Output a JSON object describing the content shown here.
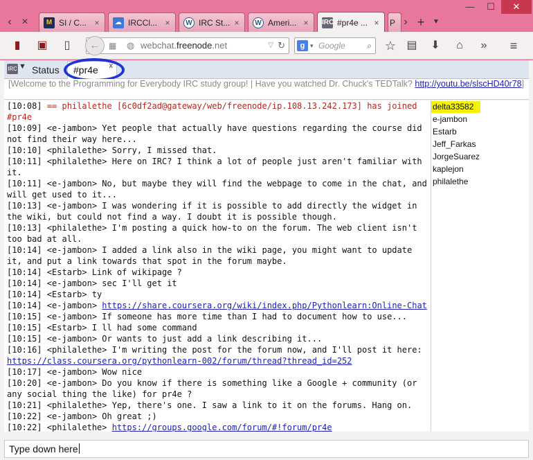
{
  "browser": {
    "tabs": [
      {
        "label": "SI / C...",
        "icon": "umich-block-m-icon",
        "icon_color": "#1f2a5c",
        "icon_fg": "#f5c518"
      },
      {
        "label": "IRCCl...",
        "icon": "cloud-icon",
        "icon_color": "#3a7ad6",
        "icon_fg": "#ffffff"
      },
      {
        "label": "IRC St...",
        "icon": "wordpress-icon",
        "icon_color": "#ffffff",
        "icon_fg": "#2a5b84"
      },
      {
        "label": "Ameri...",
        "icon": "wordpress-icon",
        "icon_color": "#ffffff",
        "icon_fg": "#2a5b84"
      },
      {
        "label": "#pr4e ...",
        "icon": "irc-cloud-icon",
        "icon_color": "#666677",
        "icon_fg": "#ffffff",
        "active": true
      },
      {
        "label": "P"
      }
    ],
    "tab_close_glyph": "×",
    "url_domain": "webchat.",
    "url_host": "freenode",
    "url_tld": ".net",
    "search_placeholder": "Google",
    "search_engine_letter": "g",
    "window_controls": {
      "minimize": "—",
      "maximize": "☐",
      "close": "✕"
    }
  },
  "irc": {
    "status_tab": "Status",
    "channel_tab": "#pr4e",
    "channel_tab_close": "x",
    "topic_text": "[Welcome to the Programming for Everybody IRC study group! | Have you watched Dr. Chuck's TEDTalk? ",
    "topic_link": "http://youtu.be/slscHD40r78",
    "topic_close": "]",
    "messages": [
      {
        "time": "[10:08]",
        "text": "== philalethe [6c0df2ad@gateway/web/freenode/ip.108.13.242.173] has joined #pr4e",
        "kind": "join"
      },
      {
        "time": "[10:09]",
        "text": "<e-jambon> Yet people that actually have questions regarding the course did not find their way here..."
      },
      {
        "time": "[10:10]",
        "text": "<philalethe> Sorry, I missed that."
      },
      {
        "time": "[10:11]",
        "text": "<philalethe> Here on IRC? I think a lot of people just aren't familiar with it."
      },
      {
        "time": "[10:11]",
        "text": "<e-jambon> No, but maybe they will find the webpage to come in the chat, and will get used to it..."
      },
      {
        "time": "[10:13]",
        "text": "<e-jambon> I was wondering if it is possible to add directly the widget in the wiki, but could not find a way. I doubt it is possible though."
      },
      {
        "time": "[10:13]",
        "text": "<philalethe> I'm posting a quick how-to on the forum. The web client isn't too bad at all."
      },
      {
        "time": "[10:14]",
        "text": "<e-jambon> I added a link also in the wiki page, you might want to update it, and put a link towards that spot in the forum maybe."
      },
      {
        "time": "[10:14]",
        "text": "<Estarb> Link of wikipage ?"
      },
      {
        "time": "[10:14]",
        "text": "<e-jambon> sec I'll get it"
      },
      {
        "time": "[10:14]",
        "text": "<Estarb> ty"
      },
      {
        "time": "[10:14]",
        "text": "<e-jambon> ",
        "link": "https://share.coursera.org/wiki/index.php/Pythonlearn:Online-Chat"
      },
      {
        "time": "[10:15]",
        "text": "<e-jambon> If someone has more time than I had to document how to use..."
      },
      {
        "time": "[10:15]",
        "text": "<Estarb> I ll had some command"
      },
      {
        "time": "[10:15]",
        "text": "<e-jambon> Or wants to just add a link describing it..."
      },
      {
        "time": "[10:16]",
        "text": "<philalethe> I'm writing the post for the forum now, and I'll post it here: ",
        "link": "https://class.coursera.org/pythonlearn-002/forum/thread?thread_id=252"
      },
      {
        "time": "[10:17]",
        "text": "<e-jambon> Wow nice"
      },
      {
        "time": "[10:20]",
        "text": "<e-jambon> Do you know if there is something like a Google + community (or any social thing the like) for pr4e ?"
      },
      {
        "time": "[10:21]",
        "text": "<philalethe> Yep, there's one. I saw a link to it on the forums. Hang on."
      },
      {
        "time": "[10:22]",
        "text": "<e-jambon> Oh great ;)"
      },
      {
        "time": "[10:22]",
        "text": "<philalethe> ",
        "link": "https://groups.google.com/forum/#!forum/pr4e"
      }
    ],
    "nicks": [
      {
        "name": "delta33582",
        "highlight": true
      },
      {
        "name": "e-jambon"
      },
      {
        "name": "Estarb"
      },
      {
        "name": "Jeff_Farkas"
      },
      {
        "name": "JorgeSuarez"
      },
      {
        "name": "kaplejon"
      },
      {
        "name": "philalethe"
      }
    ],
    "input_value": "Type down here",
    "colors": {
      "join": "#b3261e",
      "link": "#2020b0",
      "highlight": "#f5f20a",
      "annotation_circle": "#1e33d6"
    }
  }
}
